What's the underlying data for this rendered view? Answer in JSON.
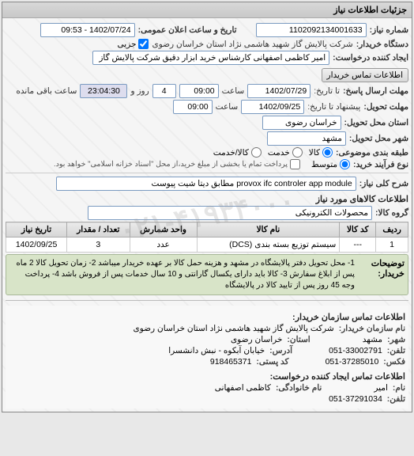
{
  "panel_header": "جزئیات اطلاعات نیاز",
  "top": {
    "need_number_label": "شماره نیاز:",
    "need_number": "1102092134001633",
    "public_datetime_label": "تاریخ و ساعت اعلان عمومی:",
    "public_datetime": "1402/07/24 - 09:53",
    "buyer_label": "دستگاه خریدار:",
    "buyer": "شرکت پالایش گاز شهید هاشمی نژاد    استان خراسان رضوی",
    "partial_label": "جزیی",
    "requester_label": "ایجاد کننده درخواست:",
    "requester": "امیر کاظمی اصفهانی کارشناس خرید ابزار دقیق شرکت پالایش گاز شهید هاش",
    "contact_btn": "اطلاعات تماس خریدار"
  },
  "dates": {
    "deadline_reply_label": "مهلت ارسال پاسخ:",
    "to_date_label": "تا تاریخ:",
    "deadline_date": "1402/07/29",
    "time_label": "ساعت",
    "deadline_time": "09:00",
    "day_label": "روز و",
    "days_left": "4",
    "time_left": "23:04:30",
    "time_left_label": "ساعت باقی مانده",
    "delivery_deadline_label": "مهلت تحویل:",
    "delivery_to_label": "پیشنهاد تا تاریخ:",
    "delivery_date": "1402/09/25",
    "delivery_time": "09:00",
    "delivery_province_label": "استان محل تحویل:",
    "delivery_province": "خراسان رضوی",
    "delivery_city_label": "شهر محل تحویل:",
    "delivery_city": "مشهد"
  },
  "subject": {
    "category_label": "طبقه بندی موضوعی:",
    "radio_goods": "کالا",
    "radio_service": "خدمت",
    "radio_goods_service": "کالا/خدمت",
    "type_label": "نوع فرآیند خرید:",
    "radio_medium": "متوسط",
    "payment_note": "پرداخت تمام یا بخشی از مبلغ خرید،از محل \"اسناد خزانه اسلامی\" خواهد بود.",
    "key_desc_label": "شرح کلی نیاز:",
    "key_desc": "provox ifc controler app module مطابق دیتا شیت پیوست"
  },
  "items": {
    "title": "اطلاعات کالاهای مورد نیاز",
    "group_label": "گروه کالا:",
    "group_value": "محصولات الکترونیکی",
    "headers": {
      "row": "ردیف",
      "code": "کد کالا",
      "name": "نام کالا",
      "unit": "واحد شمارش",
      "qty": "تعداد / مقدار",
      "need_date": "تاریخ نیاز"
    },
    "rows": [
      {
        "idx": "1",
        "code": "---",
        "name": "سیستم توزیع بسته بندی (DCS)",
        "unit": "عدد",
        "qty": "3",
        "need_date": "1402/09/25"
      }
    ]
  },
  "buyer_notes": {
    "label": "توضیحات خریدار:",
    "text": "1- محل تحویل دفتر پالایشگاه در مشهد و هزینه حمل کالا بر عهده خریدار میباشد 2- زمان تحویل کالا 2 ماه پس از ابلاغ سفارش 3- کالا باید دارای یکسال گارانتی و 10 سال خدمات پس از فروش باشد 4- پرداخت وجه 45 روز پس از تایید کالا در پالایشگاه"
  },
  "contact": {
    "title": "اطلاعات تماس سازمان خریدار:",
    "org_label": "نام سازمان خریدار:",
    "org": "شرکت پالایش گاز شهید هاشمی نژاد استان خراسان رضوی",
    "city_label": "شهر:",
    "city": "مشهد",
    "province_label": "استان:",
    "province": "خراسان رضوی",
    "phone_label": "تلفن:",
    "phone": "051-33002791",
    "address_label": "آدرس:",
    "address": "خیابان آبکوه - نبش دانشسرا",
    "fax_label": "فکس:",
    "fax": "051-37285010",
    "postal_label": "کد پستی:",
    "postal": "918465371",
    "creator_title": "اطلاعات تماس ایجاد کننده درخواست:",
    "name_label": "نام:",
    "name_value": "امیر",
    "family_label": "نام خانوادگی:",
    "family_value": "کاظمی اصفهانی",
    "tel2_label": "تلفن:",
    "tel2": "051-37291034"
  },
  "watermark": "۰۲۱-۴۱۹۳۴۰۰۰"
}
